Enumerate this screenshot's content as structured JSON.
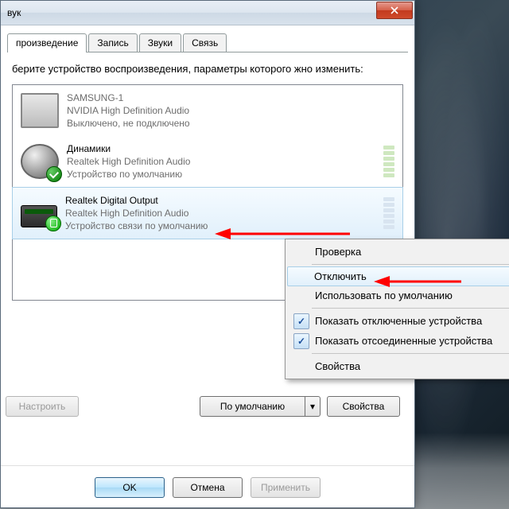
{
  "title": "вук",
  "tabs": [
    "произведение",
    "Запись",
    "Звуки",
    "Связь"
  ],
  "instruction": "берите устройство воспроизведения, параметры которого жно изменить:",
  "devices": [
    {
      "name": "SAMSUNG-1",
      "line2": "NVIDIA High Definition Audio",
      "line3": "Выключено, не подключено",
      "gray": true
    },
    {
      "name": "Динамики",
      "line2": "Realtek High Definition Audio",
      "line3": "Устройство по умолчанию",
      "gray": false
    },
    {
      "name": "Realtek Digital Output",
      "line2": "Realtek High Definition Audio",
      "line3": "Устройство связи по умолчанию",
      "gray": false
    }
  ],
  "buttons": {
    "configure": "Настроить",
    "default": "По умолчанию",
    "properties": "Свойства",
    "ok": "OK",
    "cancel": "Отмена",
    "apply": "Применить"
  },
  "context": {
    "check": "✓",
    "items": [
      {
        "label": "Проверка"
      },
      {
        "label": "Отключить",
        "hover": true
      },
      {
        "label": "Использовать по умолчанию"
      },
      {
        "label": "Показать отключенные устройства",
        "checked": true
      },
      {
        "label": "Показать отсоединенные устройства",
        "checked": true
      },
      {
        "label": "Свойства"
      }
    ]
  },
  "colors": {
    "arrow": "#ff0000"
  }
}
